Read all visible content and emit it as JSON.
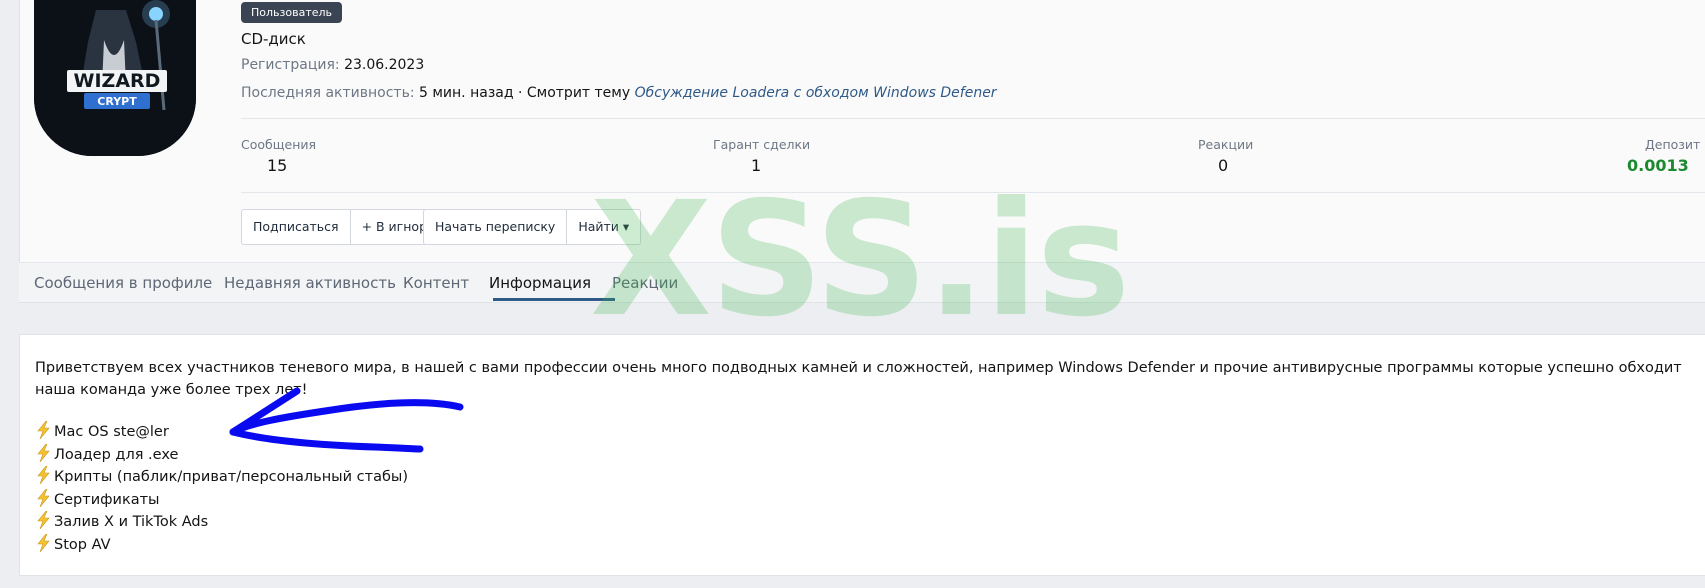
{
  "profile": {
    "role_badge": "Пользователь",
    "username": "CD-диск",
    "registration_label": "Регистрация:",
    "registration_date": "23.06.2023",
    "last_activity_label": "Последняя активность:",
    "last_activity_value": "5 мин. назад · Смотрит тему",
    "last_activity_thread": "Обсуждение Loadera с обходом Windows Defener",
    "avatar_text_main": "WIZARD",
    "avatar_text_sub": "CRYPT"
  },
  "stats": [
    {
      "label": "Сообщения",
      "value": "15"
    },
    {
      "label": "Гарант сделки",
      "value": "1"
    },
    {
      "label": "Реакции",
      "value": "0"
    },
    {
      "label": "Депозит",
      "value": "0.0013"
    }
  ],
  "buttons": {
    "subscribe": "Подписаться",
    "ignore": "+ В игнор",
    "start_conversation": "Начать переписку",
    "find": "Найти ▾"
  },
  "tabs": [
    "Сообщения в профиле",
    "Недавняя активность",
    "Контент",
    "Информация",
    "Реакции"
  ],
  "active_tab": "Информация",
  "about": {
    "intro": "Приветствуем всех участников теневого мира, в нашей с вами профессии очень много подводных камней и сложностей, например Windows Defender и прочие антивирусные программы которые успешно обходит наша команда уже более трех лет!",
    "items": [
      "Mac OS ste@ler",
      "Лоадер для .exe",
      "Крипты (паблик/приват/персональный стабы)",
      "Сертификаты",
      "Залив X и TikTok Ads",
      "Stop AV"
    ]
  },
  "watermark": "XSS.is",
  "colors": {
    "accent": "#2f5a88",
    "deposit_green": "#1b8a2e",
    "watermark_green": "#3cb450",
    "annotation_arrow": "#0a0af0"
  }
}
